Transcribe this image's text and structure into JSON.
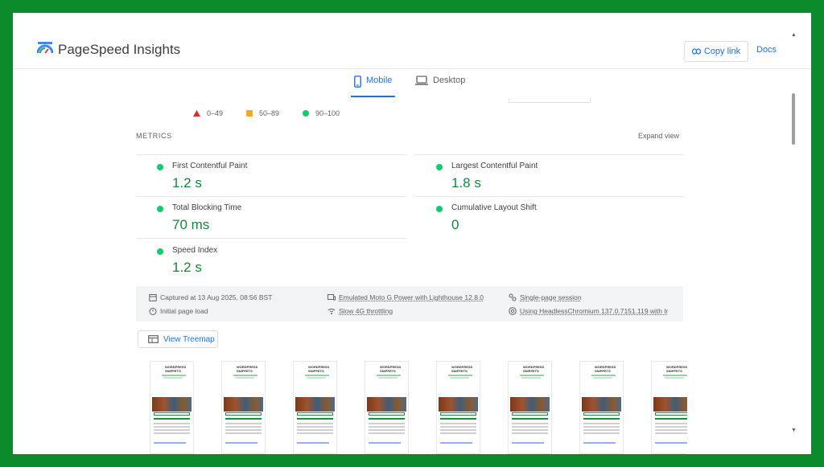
{
  "app": {
    "title": "PageSpeed Insights"
  },
  "header": {
    "copy_link_label": "Copy link",
    "docs_label": "Docs"
  },
  "tabs": [
    {
      "label": "Mobile",
      "icon": "phone-icon",
      "selected": true
    },
    {
      "label": "Desktop",
      "icon": "laptop-icon",
      "selected": false
    }
  ],
  "legend": [
    {
      "range": "0–49",
      "icon": "red-triangle-icon",
      "color": "#d93025"
    },
    {
      "range": "50–89",
      "icon": "orange-square-icon",
      "color": "#f4a72a"
    },
    {
      "range": "90–100",
      "icon": "green-circle-icon",
      "color": "#0cce6b"
    }
  ],
  "metrics": {
    "title": "METRICS",
    "expand_label": "Expand view",
    "items": [
      {
        "label": "First Contentful Paint",
        "value": "1.2 s"
      },
      {
        "label": "Largest Contentful Paint",
        "value": "1.8 s"
      },
      {
        "label": "Total Blocking Time",
        "value": "70 ms"
      },
      {
        "label": "Cumulative Layout Shift",
        "value": "0"
      },
      {
        "label": "Speed Index",
        "value": "1.2 s"
      }
    ],
    "status_color": "#0cce6b",
    "value_color": "#0d8a3a"
  },
  "run_info": {
    "captured": "Captured at 13 Aug 2025, 08:56 BST",
    "load": "Initial page load",
    "device": "Emulated Moto G Power with Lighthouse 12.8.0",
    "throttling": "Slow 4G throttling",
    "session": "Single-page session",
    "browser": "Using HeadlessChromium 137.0.7151.119 with lr"
  },
  "treemap": {
    "label": "View Treemap"
  },
  "filmstrip": {
    "frame_title": "WORDPRESS SNIPPETS",
    "frames": [
      1,
      2,
      3,
      4,
      5,
      6,
      7,
      8
    ]
  },
  "colors": {
    "accent": "#1a73e8",
    "background_border": "#0a8a2a"
  }
}
